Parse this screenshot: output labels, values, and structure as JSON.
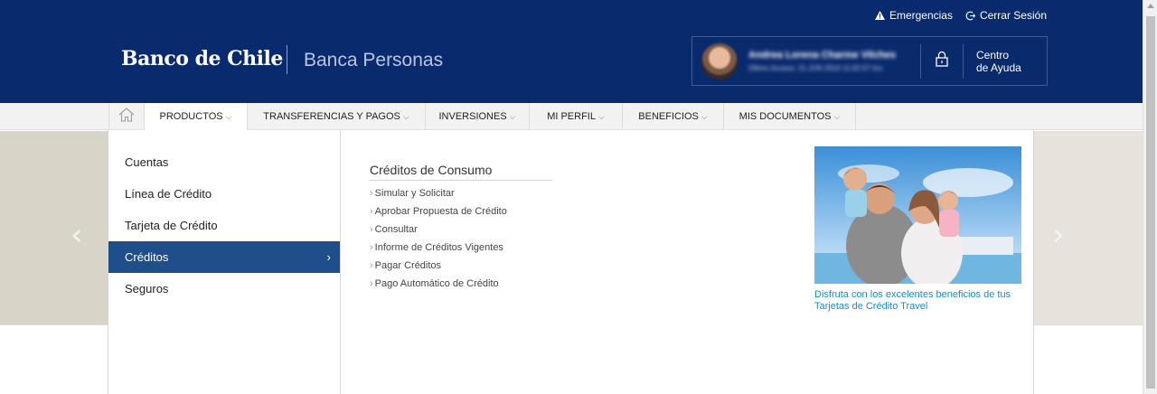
{
  "header": {
    "emergencias_label": "Emergencias",
    "logout_label": "Cerrar Sesión",
    "logo_text": "Banco de Chile",
    "section_title": "Banca Personas",
    "user_name": "Andrea Lorena Charme Vilches",
    "user_last_access": "Último Acceso: 21 JUN 2014 11:02:07 hrs.",
    "help_line1": "Centro",
    "help_line2": "de Ayuda"
  },
  "nav": {
    "items": [
      {
        "label": "PRODUCTOS"
      },
      {
        "label": "TRANSFERENCIAS Y PAGOS"
      },
      {
        "label": "INVERSIONES"
      },
      {
        "label": "MI PERFIL"
      },
      {
        "label": "BENEFICIOS"
      },
      {
        "label": "MIS DOCUMENTOS"
      }
    ]
  },
  "dropdown": {
    "categories": [
      {
        "label": "Cuentas"
      },
      {
        "label": "Línea de Crédito"
      },
      {
        "label": "Tarjeta de Crédito"
      },
      {
        "label": "Créditos",
        "selected_arrow": "›"
      },
      {
        "label": "Seguros"
      }
    ],
    "section_heading": "Créditos de Consumo",
    "links": [
      {
        "label": "Simular y Solicitar"
      },
      {
        "label": "Aprobar Propuesta de Crédito"
      },
      {
        "label": "Consultar"
      },
      {
        "label": "Informe de Créditos Vigentes"
      },
      {
        "label": "Pagar Créditos"
      },
      {
        "label": "Pago Automático de Crédito"
      }
    ],
    "promo_text": "Disfruta con los excelentes beneficios de tus Tarjetas de Crédito Travel"
  },
  "carousel": {
    "prev_glyph": "‹",
    "next_glyph": "›"
  },
  "colors": {
    "header_bg": "#0a2a6e",
    "selected_bg": "#1f4f8b",
    "link_blue": "#1b8acb"
  }
}
